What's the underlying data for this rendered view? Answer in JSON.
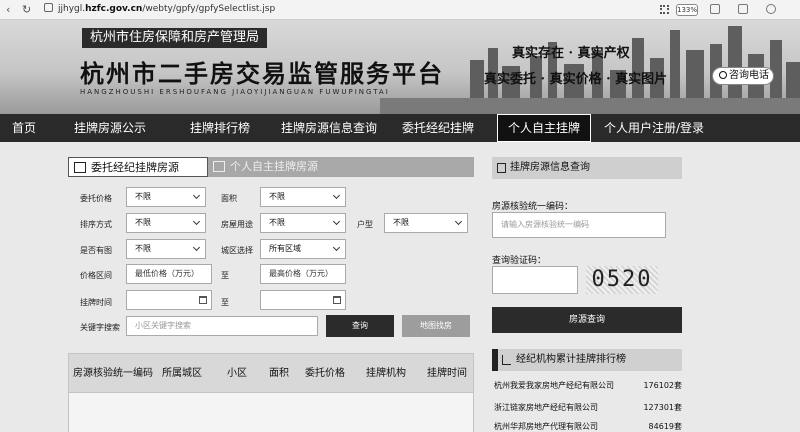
{
  "browser": {
    "url_prefix": "jjhygl.",
    "url_domain": "hzfc.gov.cn",
    "url_path": "/webty/gpfy/gpfySelectlist.jsp",
    "zoom": "133%"
  },
  "header": {
    "gov_label": "杭州市住房保障和房产管理局",
    "site_title": "杭州市二手房交易监管服务平台",
    "site_pinyin": "HANGZHOUSHI  ERSHOUFANG  JIAOYIJIANGUAN  FUWUPINGTAI",
    "slogan_line1": "真实存在 · 真实产权",
    "slogan_line2": "真实委托 · 真实价格 · 真实图片",
    "hotline": "咨询电话"
  },
  "nav": {
    "items": [
      "首页",
      "挂牌房源公示",
      "挂牌排行榜",
      "挂牌房源信息查询",
      "委托经纪挂牌",
      "个人自主挂牌",
      "个人用户注册/登录"
    ],
    "active_index": 5
  },
  "search": {
    "tabs": [
      "委托经纪挂牌房源",
      "个人自主挂牌房源"
    ],
    "labels": {
      "price": "委托价格",
      "area": "面积",
      "sort": "排序方式",
      "usage": "房屋用途",
      "layout": "户型",
      "has_image": "是否有图",
      "district": "城区选择",
      "price_range": "价格区间",
      "to": "至",
      "time": "挂牌时间",
      "keyword": "关键字搜索"
    },
    "values": {
      "price": "不限",
      "area": "不限",
      "sort": "不限",
      "usage": "不限",
      "layout": "不限",
      "has_image": "不限",
      "district": "所有区域"
    },
    "placeholders": {
      "min_price": "最低价格（万元）",
      "max_price": "最高价格（万元）",
      "keyword": "小区关键字搜索"
    },
    "buttons": {
      "query": "查询",
      "map": "地图找房"
    }
  },
  "table": {
    "headers": [
      "房源核验统一编码",
      "所属城区",
      "小区",
      "面积",
      "委托价格",
      "挂牌机构",
      "挂牌时间"
    ]
  },
  "lookup": {
    "title": "挂牌房源信息查询",
    "code_label": "房源核验统一编码：",
    "code_placeholder": "请输入房源核验统一编码",
    "captcha_label": "查询验证码：",
    "captcha_value": "0520",
    "button": "房源查询"
  },
  "ranking": {
    "title": "经纪机构累计挂牌排行榜",
    "rows": [
      {
        "name": "杭州我爱我家房地产经纪有限公司",
        "count": "176102套"
      },
      {
        "name": "浙江链家房地产经纪有限公司",
        "count": "127301套"
      },
      {
        "name": "杭州华邦房地产代理有限公司",
        "count": "84619套"
      }
    ]
  }
}
